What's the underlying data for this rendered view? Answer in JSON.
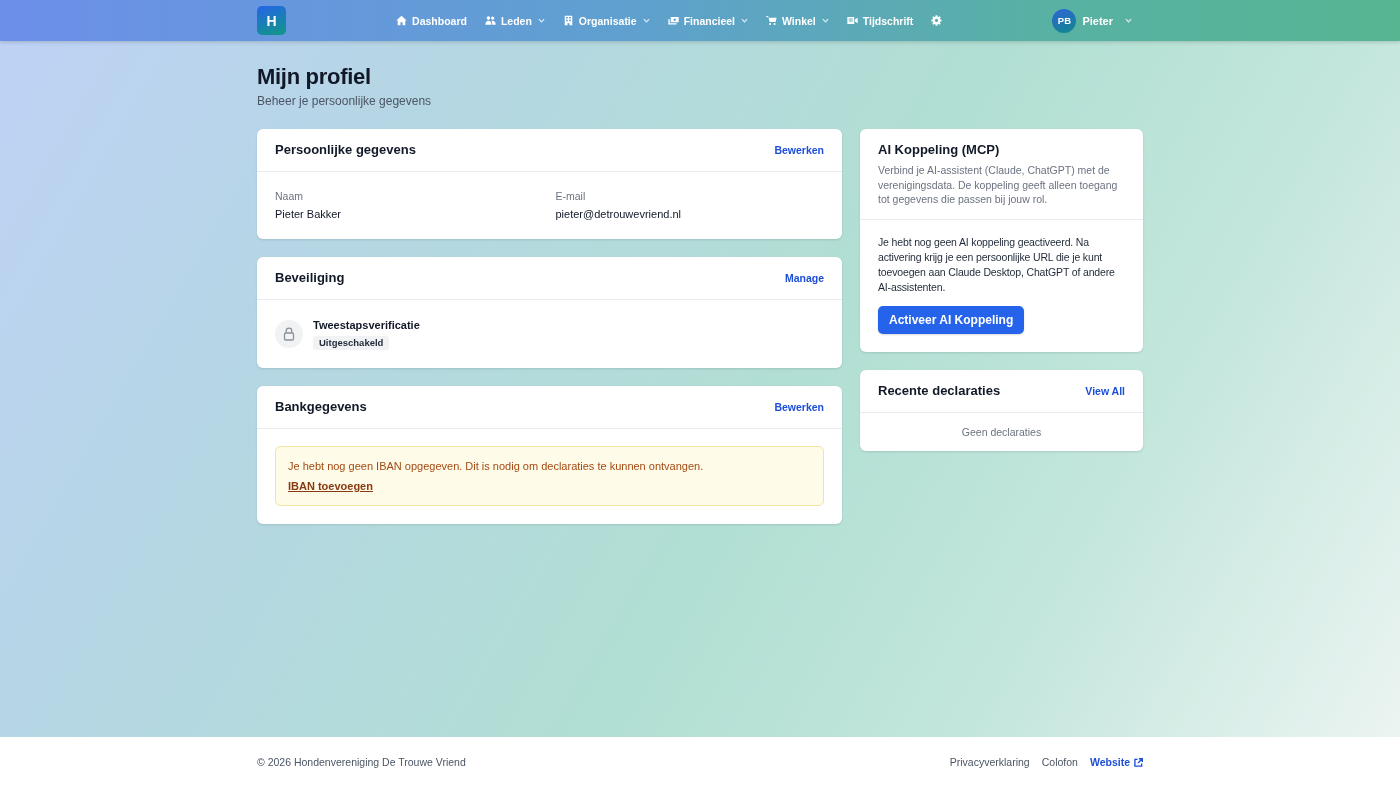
{
  "nav": {
    "logo": "H",
    "items": [
      {
        "label": "Dashboard",
        "dropdown": false
      },
      {
        "label": "Leden",
        "dropdown": true
      },
      {
        "label": "Organisatie",
        "dropdown": true
      },
      {
        "label": "Financieel",
        "dropdown": true
      },
      {
        "label": "Winkel",
        "dropdown": true
      },
      {
        "label": "Tijdschrift",
        "dropdown": false
      }
    ],
    "user": {
      "initials": "PB",
      "name": "Pieter"
    }
  },
  "page": {
    "title": "Mijn profiel",
    "subtitle": "Beheer je persoonlijke gegevens"
  },
  "personal": {
    "title": "Persoonlijke gegevens",
    "action": "Bewerken",
    "fields": [
      {
        "label": "Naam",
        "value": "Pieter Bakker"
      },
      {
        "label": "E-mail",
        "value": "pieter@detrouwevriend.nl"
      }
    ]
  },
  "security": {
    "title": "Beveiliging",
    "action": "Manage",
    "items": [
      {
        "name": "Tweestapsverificatie",
        "status": "Uitgeschakeld",
        "enabled": false
      }
    ]
  },
  "bank": {
    "title": "Bankgegevens",
    "action": "Bewerken",
    "alert": {
      "message": "Je hebt nog geen IBAN opgegeven. Dit is nodig om declaraties te kunnen ontvangen.",
      "link": "IBAN toevoegen"
    }
  },
  "ai": {
    "title": "AI Koppeling (MCP)",
    "description": "Verbind je AI-assistent (Claude, ChatGPT) met de verenigingsdata. De koppeling geeft alleen toegang tot gegevens die passen bij jouw rol.",
    "body": "Je hebt nog geen AI koppeling geactiveerd. Na activering krijg je een persoonlijke URL die je kunt toevoegen aan Claude Desktop, ChatGPT of andere AI-assistenten.",
    "button": "Activeer AI Koppeling"
  },
  "declarations": {
    "title": "Recente declaraties",
    "action": "View All",
    "empty": "Geen declaraties"
  },
  "footer": {
    "copyright": "© 2026 Hondenvereniging De Trouwe Vriend",
    "links": [
      {
        "label": "Privacyverklaring",
        "external": false
      },
      {
        "label": "Colofon",
        "external": false
      },
      {
        "label": "Website",
        "external": true
      }
    ]
  }
}
